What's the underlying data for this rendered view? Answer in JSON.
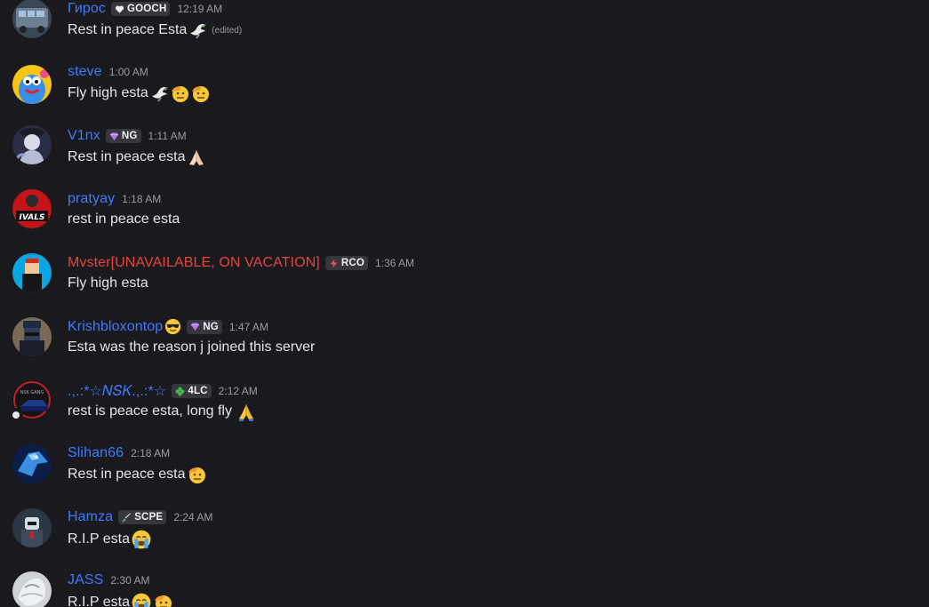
{
  "messages": [
    {
      "username": "Гирос",
      "tag": "GOOCH",
      "tag_icon": "heart-icon",
      "time": "12:19 AM",
      "text": "Rest in peace Esta",
      "emojis": [
        "dove"
      ],
      "edited_label": "(edited)"
    },
    {
      "username": "steve",
      "time": "1:00 AM",
      "text": "Fly high esta",
      "emojis": [
        "dove",
        "saluting-face",
        "saluting-face"
      ]
    },
    {
      "username": "V1nx",
      "tag": "NG",
      "tag_icon": "gem-icon",
      "time": "1:11 AM",
      "text": "Rest in peace esta",
      "emojis": [
        "folded-hands-light"
      ]
    },
    {
      "username": "pratyay",
      "time": "1:18 AM",
      "text": "rest in peace esta",
      "emojis": []
    },
    {
      "username": "Mvster[UNAVAILABLE, ON VACATION]",
      "username_color": "#e5453a",
      "tag": "RCO",
      "tag_icon": "lightning-icon",
      "time": "1:36 AM",
      "text": "Fly high esta",
      "emojis": []
    },
    {
      "username": "Krishbloxontop",
      "username_emoji": "sunglasses-face",
      "tag": "NG",
      "tag_icon": "gem-icon",
      "time": "1:47 AM",
      "text": "Esta was the reason j joined this server",
      "emojis": []
    },
    {
      "username": ".,.:*☆𝑁𝑆𝐾.,.:*☆",
      "tag": "4LC",
      "tag_icon": "clover-icon",
      "time": "2:12 AM",
      "text": "rest is peace esta, long fly",
      "emojis": [
        "folded-hands"
      ]
    },
    {
      "username": "Slihan66",
      "time": "2:18 AM",
      "text": "Rest in peace esta",
      "emojis": [
        "saluting-face"
      ]
    },
    {
      "username": "Hamza",
      "tag": "SCPE",
      "tag_icon": "sword-icon",
      "time": "2:24 AM",
      "text": "R.I.P esta",
      "emojis": [
        "crying-face"
      ]
    },
    {
      "username": "JASS",
      "time": "2:30 AM",
      "text": "R.I.P esta",
      "emojis": [
        "crying-face",
        "saluting-face"
      ]
    }
  ],
  "colors": {
    "background": "#1a1a1e",
    "username": "#3d7bfd",
    "username_red": "#e5453a",
    "text": "#e3e5e8",
    "timestamp": "#9a9ca3",
    "tag_bg": "#35373d"
  }
}
